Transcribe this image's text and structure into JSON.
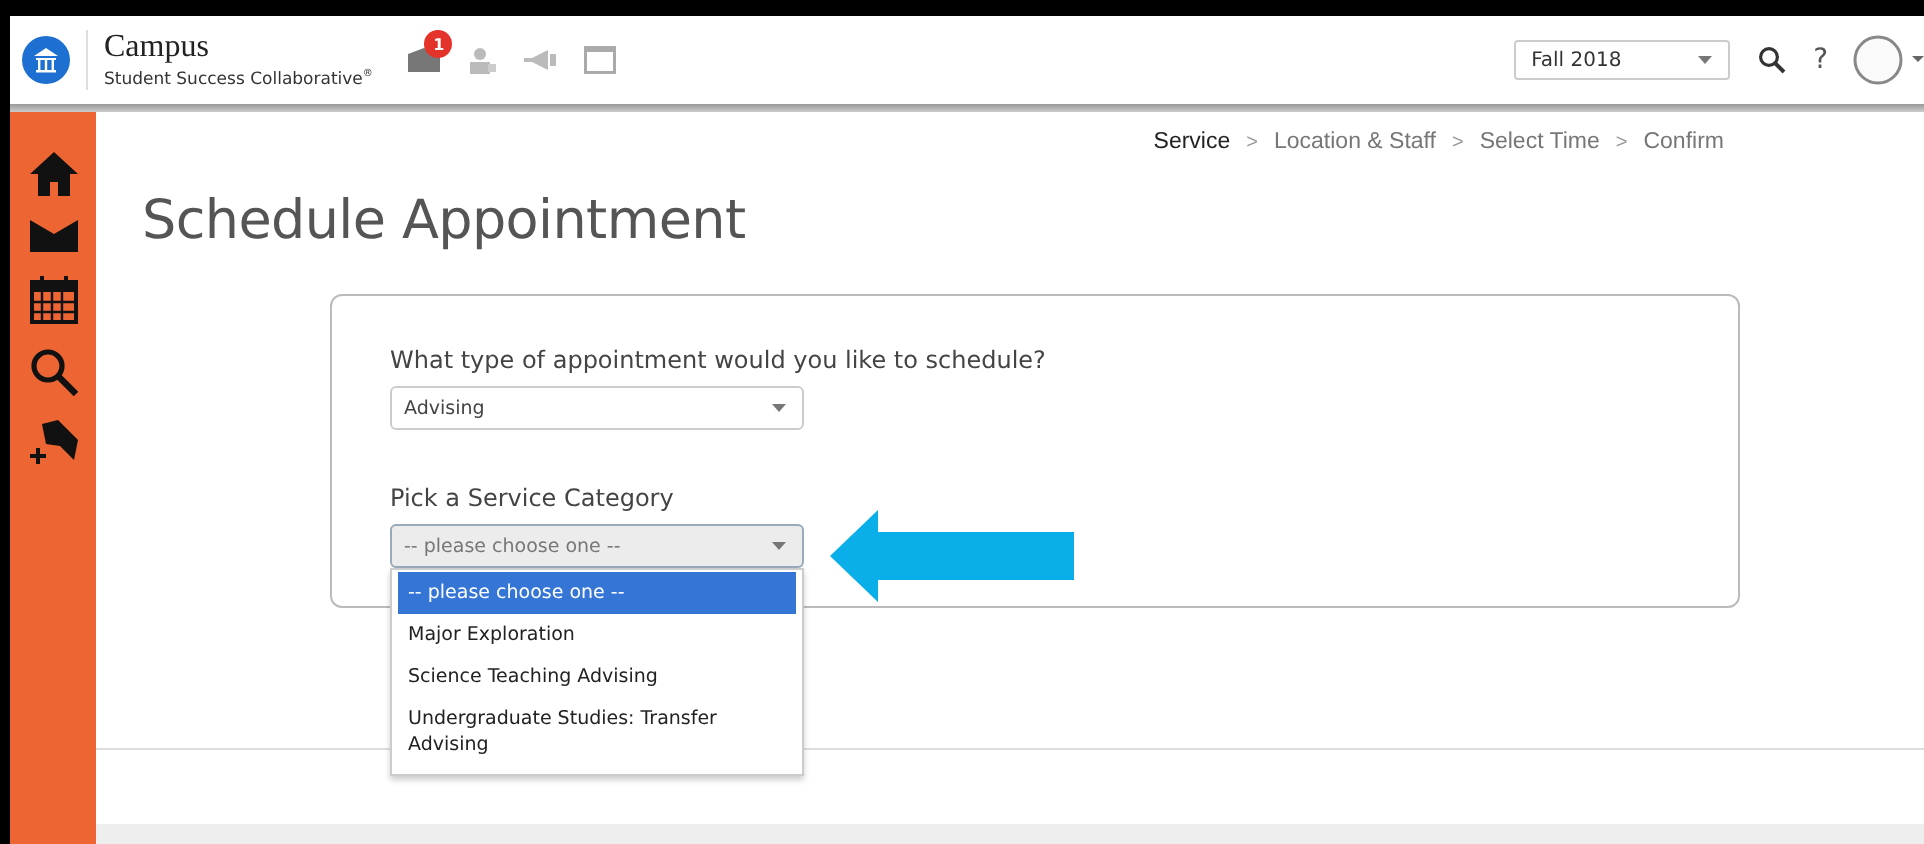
{
  "header": {
    "brand": "Campus",
    "tagline": "Student Success Collaborative",
    "tagline_mark": "®",
    "notification_count": "1",
    "term": "Fall 2018",
    "help": "?"
  },
  "sidebar": {
    "items": [
      {
        "kind": "home"
      },
      {
        "kind": "mail"
      },
      {
        "kind": "calendar"
      },
      {
        "kind": "search"
      },
      {
        "kind": "bookmark"
      }
    ]
  },
  "breadcrumb": [
    {
      "label": "Service",
      "selected": true
    },
    {
      "label": "Location & Staff",
      "selected": false
    },
    {
      "label": "Select Time",
      "selected": false
    },
    {
      "label": "Confirm",
      "selected": false
    }
  ],
  "breadcrumb_separator": ">",
  "title": "Schedule Appointment",
  "form": {
    "type_label": "What type of appointment would you like to schedule?",
    "type_value": "Advising",
    "category_label": "Pick a Service Category",
    "category_value": "-- please choose one --",
    "expanded": true,
    "options": [
      {
        "label": "-- please choose one --",
        "selected": true
      },
      {
        "label": "Major Exploration",
        "selected": false
      },
      {
        "label": "Science Teaching Advising",
        "selected": false
      },
      {
        "label": "Undergraduate Studies: Transfer Advising",
        "selected": false
      }
    ]
  }
}
